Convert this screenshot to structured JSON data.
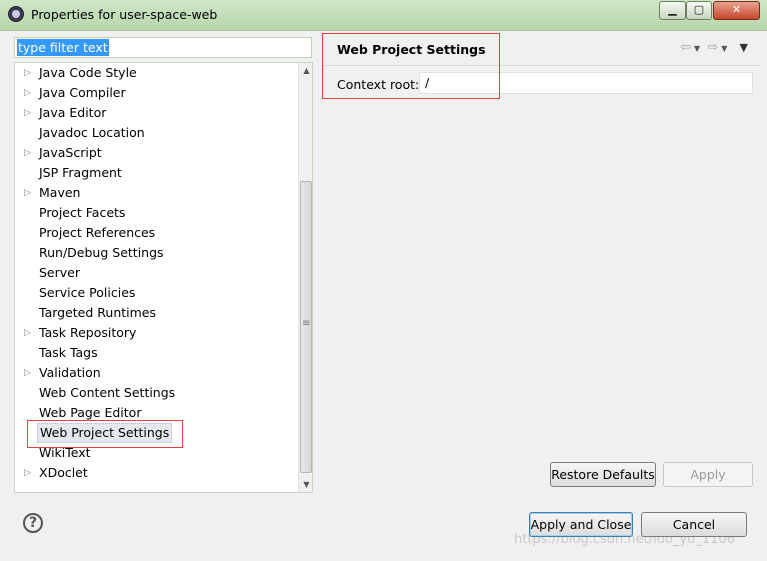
{
  "window": {
    "title": "Properties for user-space-web",
    "app_icon": "eclipse-icon",
    "controls": {
      "minimize": "▁",
      "maximize": "▢",
      "close": "✕"
    }
  },
  "filter": {
    "text": "type filter text"
  },
  "tree": {
    "items": [
      {
        "label": "Java Code Style",
        "expandable": true
      },
      {
        "label": "Java Compiler",
        "expandable": true
      },
      {
        "label": "Java Editor",
        "expandable": true
      },
      {
        "label": "Javadoc Location",
        "expandable": false
      },
      {
        "label": "JavaScript",
        "expandable": true
      },
      {
        "label": "JSP Fragment",
        "expandable": false
      },
      {
        "label": "Maven",
        "expandable": true
      },
      {
        "label": "Project Facets",
        "expandable": false
      },
      {
        "label": "Project References",
        "expandable": false
      },
      {
        "label": "Run/Debug Settings",
        "expandable": false
      },
      {
        "label": "Server",
        "expandable": false
      },
      {
        "label": "Service Policies",
        "expandable": false
      },
      {
        "label": "Targeted Runtimes",
        "expandable": false
      },
      {
        "label": "Task Repository",
        "expandable": true
      },
      {
        "label": "Task Tags",
        "expandable": false
      },
      {
        "label": "Validation",
        "expandable": true
      },
      {
        "label": "Web Content Settings",
        "expandable": false
      },
      {
        "label": "Web Page Editor",
        "expandable": false
      },
      {
        "label": "Web Project Settings",
        "expandable": false,
        "selected": true
      },
      {
        "label": "WikiText",
        "expandable": false
      },
      {
        "label": "XDoclet",
        "expandable": true
      }
    ]
  },
  "page": {
    "heading": "Web Project Settings",
    "context_root_label": "Context root:",
    "context_root_value": "/",
    "restore_defaults": "Restore Defaults",
    "apply": "Apply"
  },
  "footer": {
    "apply_and_close": "Apply and Close",
    "cancel": "Cancel",
    "help": "?"
  },
  "watermark": "https://blog.csdn.net/luo_yu_1106",
  "colors": {
    "annotation_red": "#e0403a",
    "selection_blue": "#3399ff"
  }
}
